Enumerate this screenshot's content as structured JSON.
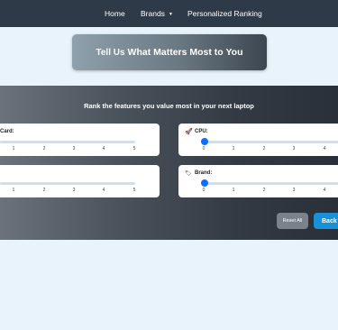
{
  "nav": {
    "home": "Home",
    "brands": "Brands",
    "ranking": "Personalized Ranking"
  },
  "banner": {
    "prefix": "Tell Us",
    "emphasis": "What Matters Most to You"
  },
  "panel": {
    "title": "Rank the features you value most in your next laptop",
    "cards": [
      {
        "label": "Card:",
        "ticks": [
          "1",
          "2",
          "3",
          "4",
          "5"
        ],
        "value": 0
      },
      {
        "label": "CPU:",
        "icon": "rocket-icon",
        "ticks": [
          "0",
          "1",
          "2",
          "3",
          "4"
        ],
        "value": 0
      },
      {
        "label": "",
        "ticks": [
          "1",
          "2",
          "3",
          "4",
          "5"
        ],
        "value": 0
      },
      {
        "label": "Brand:",
        "icon": "tag-icon",
        "ticks": [
          "0",
          "1",
          "2",
          "3",
          "4"
        ],
        "value": 0
      }
    ],
    "reset_label": "Reset All",
    "back_label": "Back"
  },
  "colors": {
    "navbar": "#2f3a48",
    "slider_thumb": "#0d6efd",
    "back_button": "#1a91d6",
    "reset_button": "#7a838c",
    "page_bg": "#e8f3fb"
  }
}
